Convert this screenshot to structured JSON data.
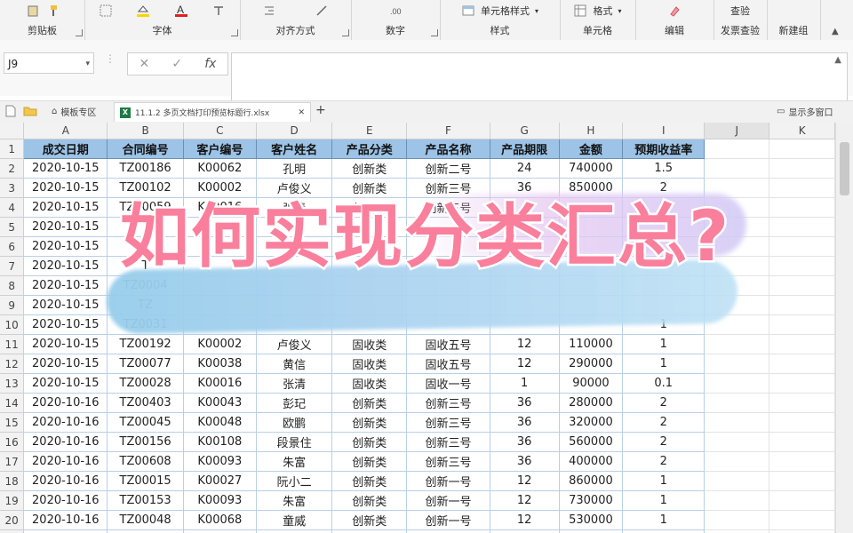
{
  "ribbon": {
    "groups": [
      {
        "label": "剪贴板",
        "controls": [],
        "icons": [
          "paste-icon",
          "format-painter-icon"
        ]
      },
      {
        "label": "字体",
        "controls": [],
        "icons": [
          "border-icon",
          "fill-color-icon",
          "font-color-icon",
          "text-direction-icon"
        ]
      },
      {
        "label": "对齐方式",
        "controls": [],
        "icons": [
          "indent-icon",
          "orientation-icon"
        ]
      },
      {
        "label": "数字",
        "controls": [],
        "icons": [
          "number-format-icon"
        ]
      },
      {
        "label": "样式",
        "controls": [
          "单元格样式"
        ],
        "icons": []
      },
      {
        "label": "单元格",
        "controls": [
          "格式"
        ],
        "icons": []
      },
      {
        "label": "编辑",
        "controls": [],
        "icons": [
          "clear-icon"
        ]
      },
      {
        "label": "发票查验",
        "controls": [
          "查验"
        ],
        "icons": []
      },
      {
        "label": "新建组",
        "controls": [],
        "icons": []
      }
    ]
  },
  "formula_bar": {
    "name_box": "J9",
    "fx": "fx",
    "formula": ""
  },
  "tabs": {
    "template_area": "模板专区",
    "file_tab": "11.1.2 多页文档打印预览标题行.xlsx",
    "show_multi_window": "显示多窗口"
  },
  "grid": {
    "columns": [
      "A",
      "B",
      "C",
      "D",
      "E",
      "F",
      "G",
      "H",
      "I",
      "J",
      "K"
    ],
    "selected_column": "J",
    "headers": [
      "成交日期",
      "合同编号",
      "客户编号",
      "客户姓名",
      "产品分类",
      "产品名称",
      "产品期限",
      "金额",
      "预期收益率"
    ],
    "rows": [
      [
        "2020-10-15",
        "TZ00186",
        "K00062",
        "孔明",
        "创新类",
        "创新二号",
        "24",
        "740000",
        "1.5"
      ],
      [
        "2020-10-15",
        "TZ00102",
        "K00002",
        "卢俊义",
        "创新类",
        "创新三号",
        "36",
        "850000",
        "2"
      ],
      [
        "2020-10-15",
        "TZ00059",
        "K00016",
        "张清",
        "创新类",
        "创新三号",
        "",
        "",
        "2"
      ],
      [
        "2020-10-15",
        "T",
        "",
        "",
        "",
        "",
        "",
        "",
        ""
      ],
      [
        "2020-10-15",
        "T",
        "",
        "",
        "",
        "",
        "",
        "",
        ""
      ],
      [
        "2020-10-15",
        "T",
        "",
        "",
        "",
        "",
        "",
        "",
        ""
      ],
      [
        "2020-10-15",
        "TZ0004",
        "",
        "",
        "",
        "",
        "",
        "",
        ""
      ],
      [
        "2020-10-15",
        "TZ",
        "",
        "",
        "",
        "",
        "",
        "",
        ""
      ],
      [
        "2020-10-15",
        "TZ0031",
        "",
        "",
        "",
        "",
        "",
        "",
        "1"
      ],
      [
        "2020-10-15",
        "TZ00192",
        "K00002",
        "卢俊义",
        "固收类",
        "固收五号",
        "12",
        "110000",
        "1"
      ],
      [
        "2020-10-15",
        "TZ00077",
        "K00038",
        "黄信",
        "固收类",
        "固收五号",
        "12",
        "290000",
        "1"
      ],
      [
        "2020-10-15",
        "TZ00028",
        "K00016",
        "张清",
        "固收类",
        "固收一号",
        "1",
        "90000",
        "0.1"
      ],
      [
        "2020-10-16",
        "TZ00403",
        "K00043",
        "彭玘",
        "创新类",
        "创新三号",
        "36",
        "280000",
        "2"
      ],
      [
        "2020-10-16",
        "TZ00045",
        "K00048",
        "欧鹏",
        "创新类",
        "创新三号",
        "36",
        "320000",
        "2"
      ],
      [
        "2020-10-16",
        "TZ00156",
        "K00108",
        "段景住",
        "创新类",
        "创新三号",
        "36",
        "560000",
        "2"
      ],
      [
        "2020-10-16",
        "TZ00608",
        "K00093",
        "朱富",
        "创新类",
        "创新三号",
        "36",
        "400000",
        "2"
      ],
      [
        "2020-10-16",
        "TZ00015",
        "K00027",
        "阮小二",
        "创新类",
        "创新一号",
        "12",
        "860000",
        "1"
      ],
      [
        "2020-10-16",
        "TZ00153",
        "K00093",
        "朱富",
        "创新类",
        "创新一号",
        "12",
        "730000",
        "1"
      ],
      [
        "2020-10-16",
        "TZ00048",
        "K00068",
        "童威",
        "创新类",
        "创新一号",
        "12",
        "530000",
        "1"
      ],
      [
        "2020-10-16",
        "TZ00415",
        "K00088",
        "汤隆",
        "固收类",
        "固收三号",
        "3",
        "200000",
        "0.25"
      ]
    ]
  },
  "overlay": {
    "headline": "如何实现分类汇总?"
  }
}
